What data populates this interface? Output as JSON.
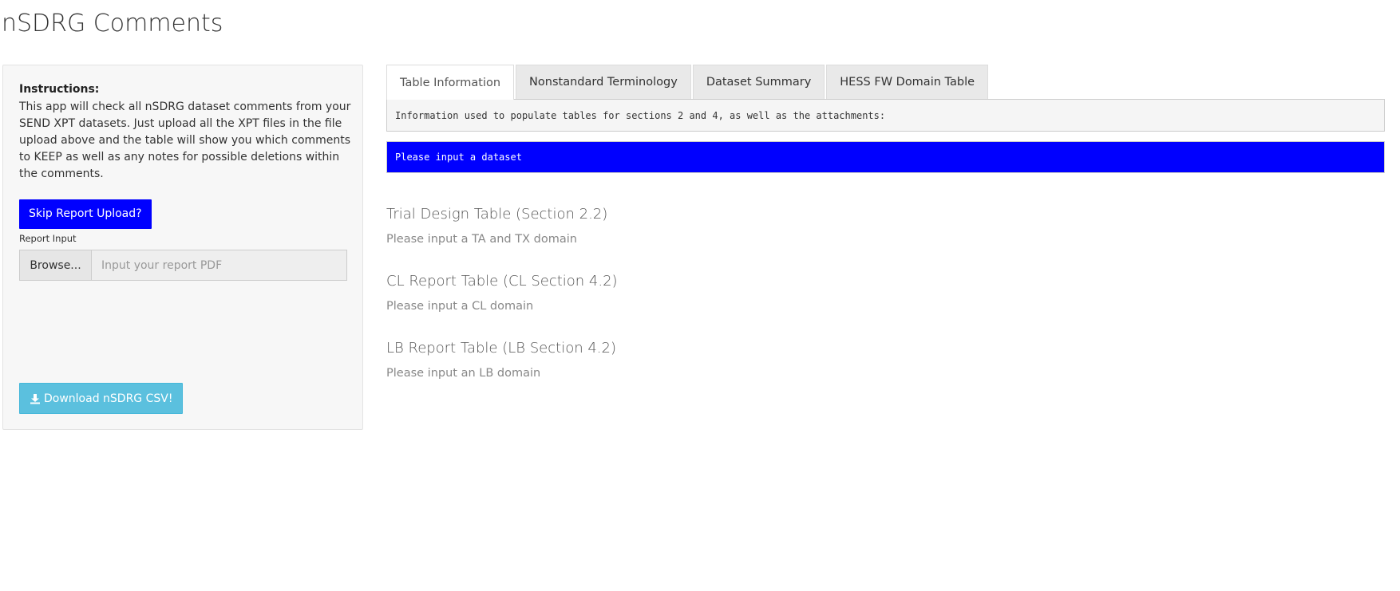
{
  "page": {
    "title": "nSDRG Comments"
  },
  "sidebar": {
    "instructions_heading": "Instructions:",
    "instructions_text": "This app will check all nSDRG dataset comments from your SEND XPT datasets. Just upload all the XPT files in the file upload above and the table will show you which comments to KEEP as well as any notes for possible deletions within the comments.",
    "skip_button": "Skip Report Upload?",
    "report_input_label": "Report Input",
    "browse_button": "Browse...",
    "file_placeholder": "Input your report PDF",
    "download_button": "Download nSDRG CSV!",
    "download_icon": "download-icon"
  },
  "main": {
    "tabs": [
      {
        "label": "Table Information",
        "active": true
      },
      {
        "label": "Nonstandard Terminology",
        "active": false
      },
      {
        "label": "Dataset Summary",
        "active": false
      },
      {
        "label": "HESS FW Domain Table",
        "active": false
      }
    ],
    "info_text": "Information used to populate tables for sections 2 and 4, as well as the attachments:",
    "alert_text": "Please input a dataset",
    "sections": [
      {
        "title": "Trial Design Table (Section 2.2)",
        "note": "Please input a TA and TX domain"
      },
      {
        "title": "CL Report Table (CL Section 4.2)",
        "note": "Please input a CL domain"
      },
      {
        "title": "LB Report Table (LB Section 4.2)",
        "note": "Please input an LB domain"
      }
    ]
  },
  "colors": {
    "primary_blue": "#0000ff",
    "download_button": "#5bc0de",
    "sidebar_bg": "#f7f7f7"
  }
}
